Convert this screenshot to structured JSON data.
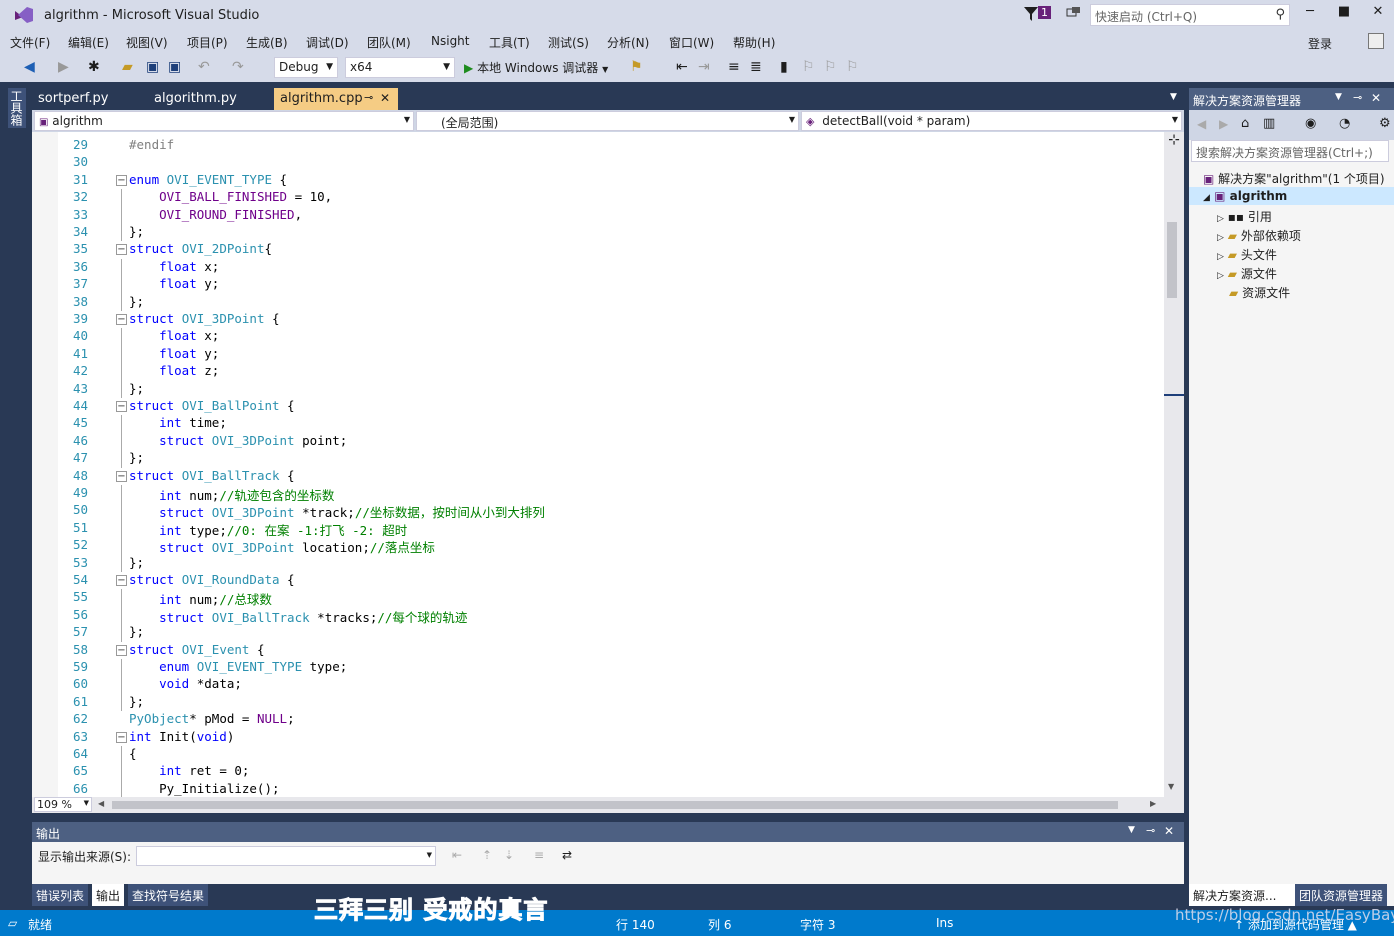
{
  "window": {
    "title": "algrithm - Microsoft Visual Studio",
    "notification_count": "1",
    "quick_launch_placeholder": "快速启动 (Ctrl+Q)",
    "sign_in": "登录"
  },
  "menu": [
    "文件(F)",
    "编辑(E)",
    "视图(V)",
    "项目(P)",
    "生成(B)",
    "调试(D)",
    "团队(M)",
    "Nsight",
    "工具(T)",
    "测试(S)",
    "分析(N)",
    "窗口(W)",
    "帮助(H)"
  ],
  "toolbar": {
    "config": "Debug",
    "platform": "x64",
    "run_label": "本地 Windows 调试器"
  },
  "sidebar": {
    "toolbox": "工具箱"
  },
  "tabs": [
    {
      "label": "sortperf.py"
    },
    {
      "label": "algorithm.py"
    },
    {
      "label": "algrithm.cpp",
      "active": true
    }
  ],
  "navbar": {
    "project": "algrithm",
    "scope": "(全局范围)",
    "member": "detectBall(void * param)"
  },
  "editor": {
    "zoom": "109 %",
    "lines": [
      {
        "n": "29",
        "text": "#endif"
      },
      {
        "n": "30",
        "text": ""
      },
      {
        "n": "31",
        "text": "enum OVI_EVENT_TYPE {"
      },
      {
        "n": "32",
        "text": "    OVI_BALL_FINISHED = 10,"
      },
      {
        "n": "33",
        "text": "    OVI_ROUND_FINISHED,"
      },
      {
        "n": "34",
        "text": "};"
      },
      {
        "n": "35",
        "text": "struct OVI_2DPoint{"
      },
      {
        "n": "36",
        "text": "    float x;"
      },
      {
        "n": "37",
        "text": "    float y;"
      },
      {
        "n": "38",
        "text": "};"
      },
      {
        "n": "39",
        "text": "struct OVI_3DPoint {"
      },
      {
        "n": "40",
        "text": "    float x;"
      },
      {
        "n": "41",
        "text": "    float y;"
      },
      {
        "n": "42",
        "text": "    float z;"
      },
      {
        "n": "43",
        "text": "};"
      },
      {
        "n": "44",
        "text": "struct OVI_BallPoint {"
      },
      {
        "n": "45",
        "text": "    int time;"
      },
      {
        "n": "46",
        "text": "    struct OVI_3DPoint point;"
      },
      {
        "n": "47",
        "text": "};"
      },
      {
        "n": "48",
        "text": "struct OVI_BallTrack {"
      },
      {
        "n": "49",
        "text": "    int num;//轨迹包含的坐标数"
      },
      {
        "n": "50",
        "text": "    struct OVI_3DPoint *track;//坐标数据，按时间从小到大排列"
      },
      {
        "n": "51",
        "text": "    int type;//0: 在案 -1:打飞 -2: 超时"
      },
      {
        "n": "52",
        "text": "    struct OVI_3DPoint location;//落点坐标"
      },
      {
        "n": "53",
        "text": "};"
      },
      {
        "n": "54",
        "text": "struct OVI_RoundData {"
      },
      {
        "n": "55",
        "text": "    int num;//总球数"
      },
      {
        "n": "56",
        "text": "    struct OVI_BallTrack *tracks;//每个球的轨迹"
      },
      {
        "n": "57",
        "text": "};"
      },
      {
        "n": "58",
        "text": "struct OVI_Event {"
      },
      {
        "n": "59",
        "text": "    enum OVI_EVENT_TYPE type;"
      },
      {
        "n": "60",
        "text": "    void *data;"
      },
      {
        "n": "61",
        "text": "};"
      },
      {
        "n": "62",
        "text": "PyObject* pMod = NULL;"
      },
      {
        "n": "63",
        "text": "int Init(void)"
      },
      {
        "n": "64",
        "text": "{"
      },
      {
        "n": "65",
        "text": "    int ret = 0;"
      },
      {
        "n": "66",
        "text": "    Py_Initialize();"
      }
    ]
  },
  "output": {
    "title": "输出",
    "source_label": "显示输出来源(S):",
    "tabs": [
      "错误列表",
      "输出",
      "查找符号结果"
    ]
  },
  "solution": {
    "title": "解决方案资源管理器",
    "search_placeholder": "搜索解决方案资源管理器(Ctrl+;)",
    "root": "解决方案\"algrithm\"(1 个项目)",
    "project": "algrithm",
    "items": [
      "引用",
      "外部依赖项",
      "头文件",
      "源文件",
      "资源文件"
    ],
    "tabs": [
      "解决方案资源...",
      "团队资源管理器"
    ]
  },
  "status": {
    "ready": "就绪",
    "line": "行 140",
    "col": "列 6",
    "char": "字符 3",
    "mode": "Ins",
    "source_control": "↑ 添加到源代码管理 ▲"
  },
  "overlay": {
    "subtitle": "三拜三别  受戒的真言",
    "watermark": "https://blog.csdn.net/EasyBay"
  }
}
